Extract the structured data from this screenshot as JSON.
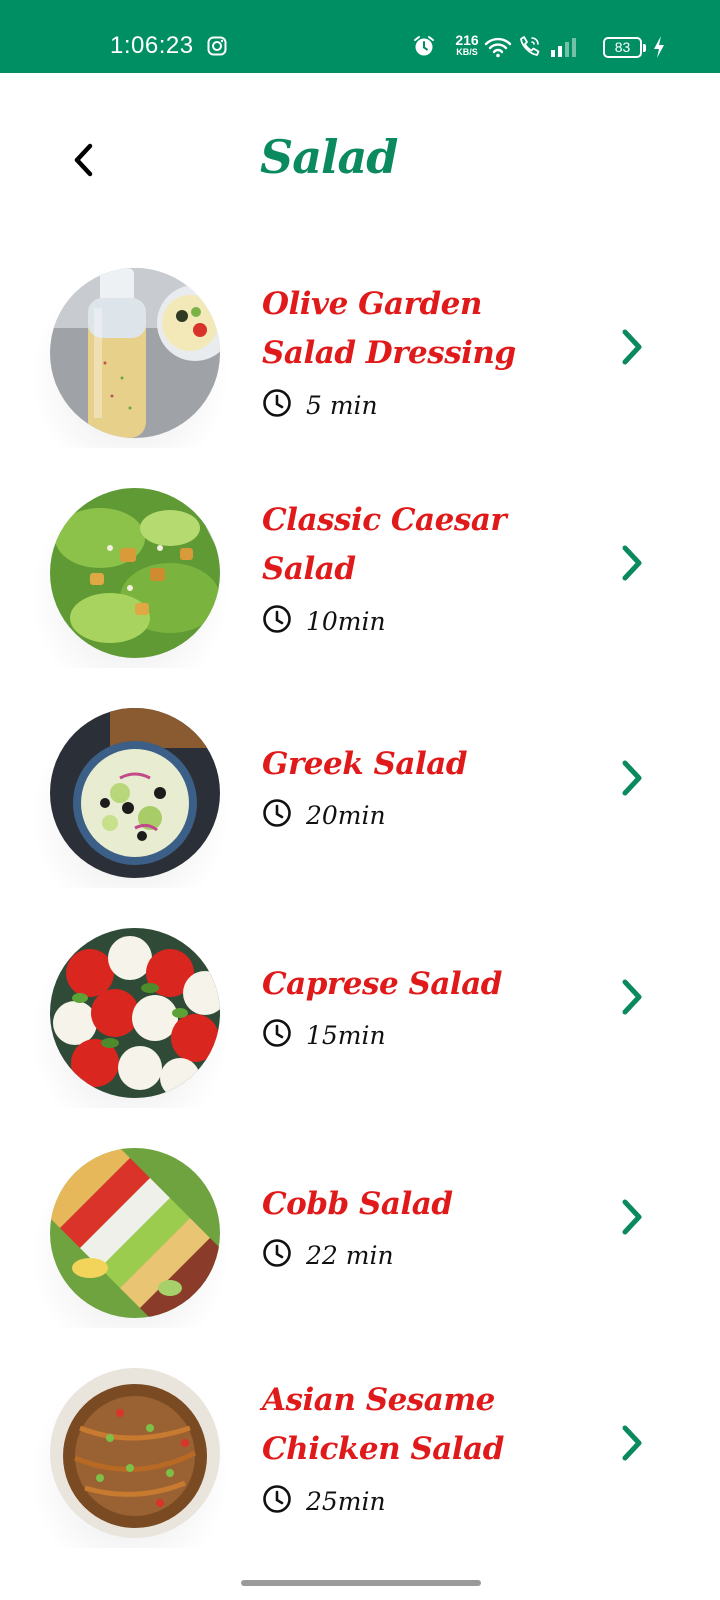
{
  "status_bar": {
    "time": "1:06:23",
    "net_speed_value": "216",
    "net_speed_unit": "KB/S",
    "battery_level": "83",
    "icons": [
      "instagram-icon",
      "alarm-icon",
      "wifi-icon",
      "volte-call-icon",
      "signal-icon",
      "battery-icon",
      "charging-icon"
    ]
  },
  "header": {
    "title": "Salad",
    "back_icon": "chevron-left-icon"
  },
  "recipes": [
    {
      "name_line1": "Olive Garden",
      "name_line2": "Salad Dressing",
      "time": "5 min"
    },
    {
      "name_line1": "Classic Caesar",
      "name_line2": "Salad",
      "time": "10min"
    },
    {
      "name_line1": "Greek Salad",
      "name_line2": "",
      "time": "20min"
    },
    {
      "name_line1": "Caprese Salad",
      "name_line2": "",
      "time": "15min"
    },
    {
      "name_line1": "Cobb Salad",
      "name_line2": "",
      "time": "22 min"
    },
    {
      "name_line1": "Asian Sesame",
      "name_line2": "Chicken Salad",
      "time": "25min"
    }
  ],
  "colors": {
    "status_bar": "#008f62",
    "title": "#0b8a5f",
    "recipe_name": "#e01a1a",
    "chevron": "#0b8a5f"
  }
}
